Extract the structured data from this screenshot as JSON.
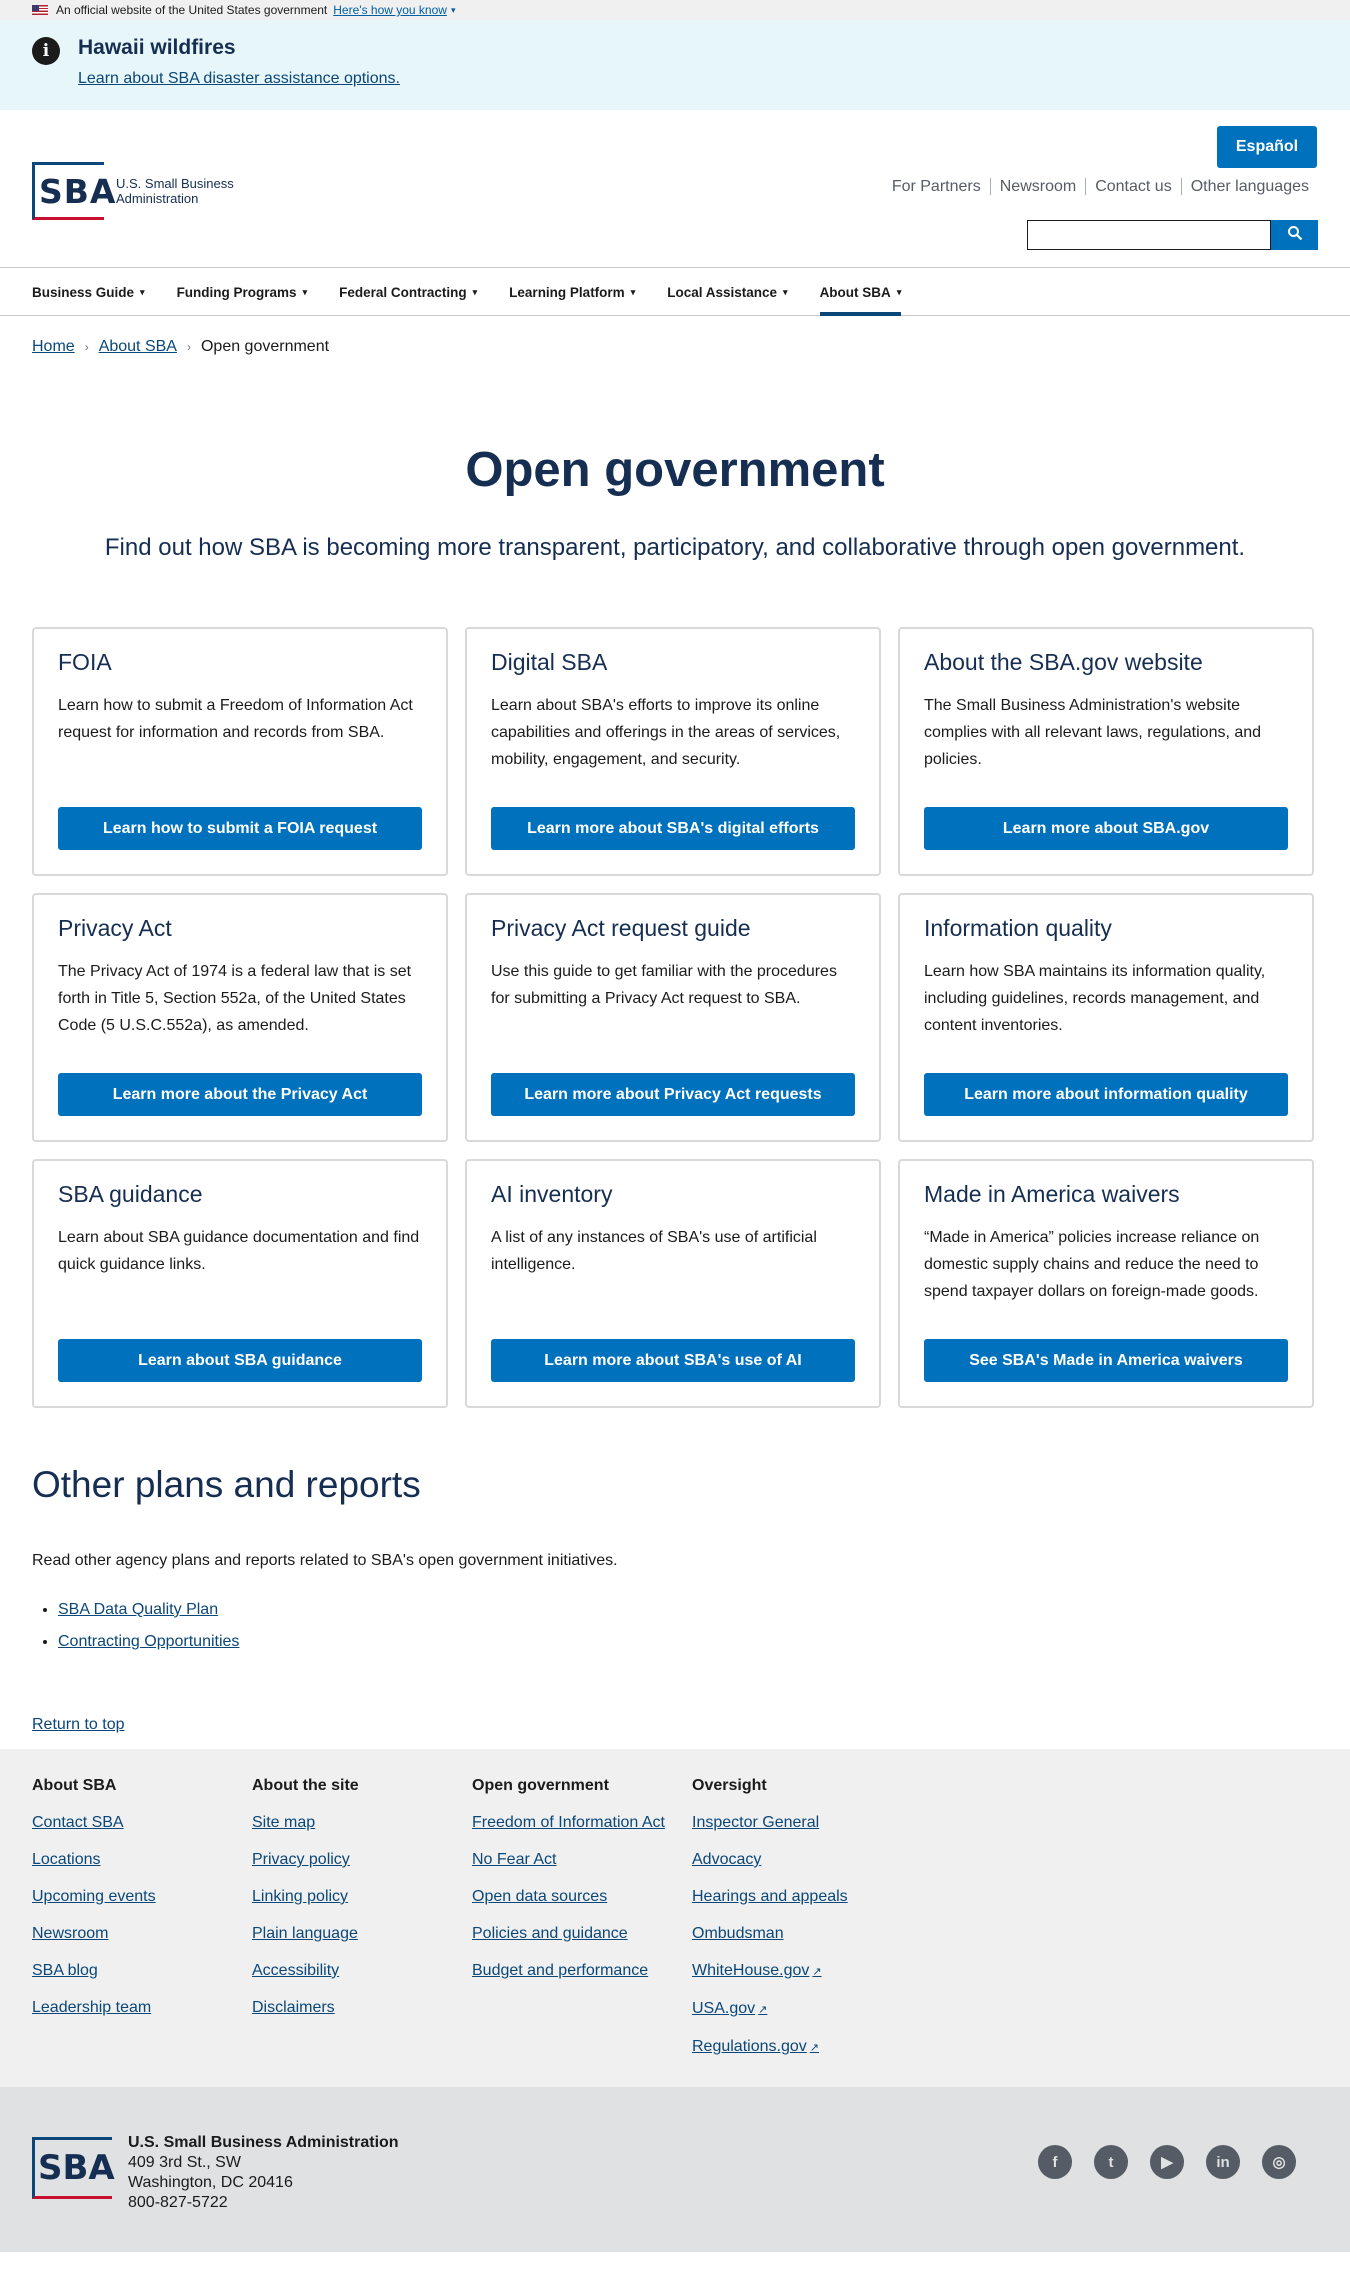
{
  "gov_banner": {
    "text": "An official website of the United States government",
    "link": "Here's how you know"
  },
  "alert": {
    "title": "Hawaii wildfires",
    "link": "Learn about SBA disaster assistance options."
  },
  "header": {
    "logo_mark": "SBA",
    "logo_line1": "U.S. Small Business",
    "logo_line2": "Administration",
    "espanol": "Español",
    "util_links": [
      "For Partners",
      "Newsroom",
      "Contact us",
      "Other languages"
    ],
    "search_placeholder": ""
  },
  "nav": [
    "Business Guide",
    "Funding Programs",
    "Federal Contracting",
    "Learning Platform",
    "Local Assistance",
    "About SBA"
  ],
  "breadcrumb": {
    "home": "Home",
    "about": "About SBA",
    "current": "Open government"
  },
  "hero": {
    "title": "Open government",
    "subtitle": "Find out how SBA is becoming more transparent, participatory, and collaborative through open government."
  },
  "cards": [
    {
      "title": "FOIA",
      "text": "Learn how to submit a Freedom of Information Act request for information and records from SBA.",
      "button": "Learn how to submit a FOIA request"
    },
    {
      "title": "Digital SBA",
      "text": "Learn about SBA's efforts to improve its online capabilities and offerings in the areas of services, mobility, engagement, and security.",
      "button": "Learn more about SBA's digital efforts"
    },
    {
      "title": "About the SBA.gov website",
      "text": "The Small Business Administration's website complies with all relevant laws, regulations, and policies.",
      "button": "Learn more about SBA.gov"
    },
    {
      "title": "Privacy Act",
      "text": "The Privacy Act of 1974 is a federal law that is set forth in Title 5, Section 552a, of the United States Code (5 U.S.C.552a), as amended.",
      "button": "Learn more about the Privacy Act"
    },
    {
      "title": "Privacy Act request guide",
      "text": "Use this guide to get familiar with the procedures for submitting a Privacy Act request to SBA.",
      "button": "Learn more about Privacy Act requests"
    },
    {
      "title": "Information quality",
      "text": "Learn how SBA maintains its information quality, including guidelines, records management, and content inventories.",
      "button": "Learn more about information quality"
    },
    {
      "title": "SBA guidance",
      "text": "Learn about SBA guidance documentation and find quick guidance links.",
      "button": "Learn about SBA guidance"
    },
    {
      "title": "AI inventory",
      "text": "A list of any instances of SBA's use of artificial intelligence.",
      "button": "Learn more about SBA's use of AI"
    },
    {
      "title": "Made in America waivers",
      "text": "“Made in America” policies increase reliance on domestic supply chains and reduce the need to spend taxpayer dollars on foreign-made goods.",
      "button": "See SBA's Made in America waivers"
    }
  ],
  "other": {
    "title": "Other plans and reports",
    "intro": "Read other agency plans and reports related to SBA's open government initiatives.",
    "links": [
      "SBA Data Quality Plan",
      "Contracting Opportunities"
    ]
  },
  "return_top": "Return to top",
  "footer": {
    "columns": [
      {
        "title": "About SBA",
        "links": [
          "Contact SBA",
          "Locations",
          "Upcoming events",
          "Newsroom",
          "SBA blog",
          "Leadership team"
        ]
      },
      {
        "title": "About the site",
        "links": [
          "Site map",
          "Privacy policy",
          "Linking policy",
          "Plain language",
          "Accessibility",
          "Disclaimers"
        ]
      },
      {
        "title": "Open government",
        "links": [
          "Freedom of Information Act",
          "No Fear Act",
          "Open data sources",
          "Policies and guidance",
          "Budget and performance"
        ]
      },
      {
        "title": "Oversight",
        "links": [
          "Inspector General",
          "Advocacy",
          "Hearings and appeals",
          "Ombudsman",
          "WhiteHouse.gov",
          "USA.gov",
          "Regulations.gov"
        ]
      }
    ],
    "address": {
      "org": "U.S. Small Business Administration",
      "street": "409 3rd St., SW",
      "city": "Washington, DC 20416",
      "phone": "800-827-5722"
    },
    "social": [
      "facebook-icon",
      "twitter-icon",
      "youtube-icon",
      "linkedin-icon",
      "instagram-icon"
    ]
  }
}
